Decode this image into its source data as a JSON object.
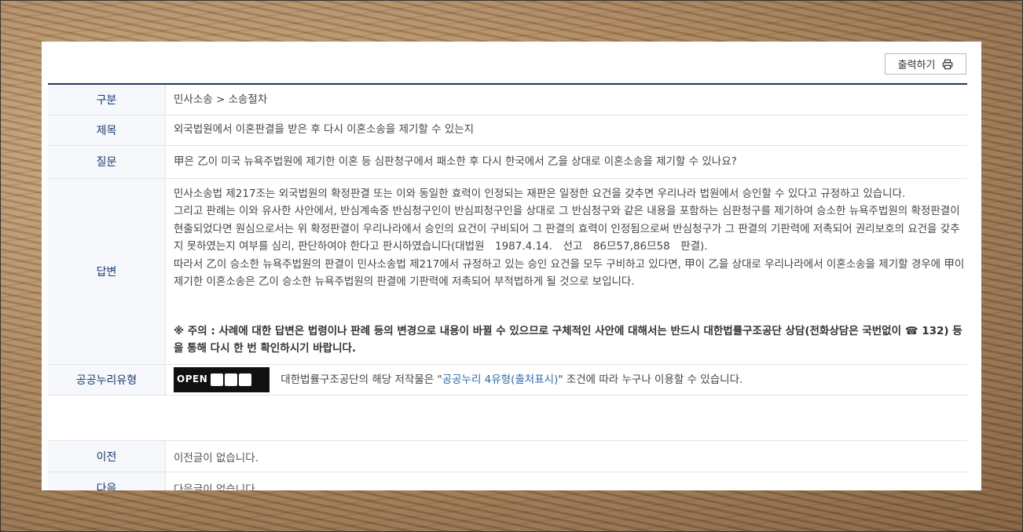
{
  "toolbar": {
    "print_label": "출력하기",
    "print_icon": "printer-icon"
  },
  "rows": {
    "category": {
      "label": "구분",
      "value": "민사소송 > 소송절차"
    },
    "title": {
      "label": "제목",
      "value": "외국법원에서 이혼판결을 받은 후 다시 이혼소송을 제기할 수 있는지"
    },
    "question": {
      "label": "질문",
      "value": "甲은 乙이 미국 뉴욕주법원에 제기한 이혼 등 심판청구에서 패소한 후 다시 한국에서 乙을 상대로 이혼소송을 제기할 수 있나요?"
    },
    "answer": {
      "label": "답변",
      "paragraphs": [
        "민사소송법 제217조는 외국법원의 확정판결 또는 이와 동일한 효력이 인정되는 재판은 일정한 요건을 갖추면 우리나라 법원에서 승인할 수 있다고 규정하고 있습니다.",
        "그리고 판례는 이와 유사한 사안에서, 반심계속중 반심청구인이 반심피청구인을 상대로 그 반심청구와 같은 내용을 포함하는 심판청구를 제기하여 승소한 뉴욕주법원의 확정판결이 현출되었다면 원심으로서는 위 확정판결이 우리나라에서 승인의 요건이 구비되어 그 판결의 효력이 인정됨으로써 반심청구가 그 판결의 기판력에 저촉되어 권리보호의 요건을 갖추지 못하였는지 여부를 심리, 판단하여야 한다고 판시하였습니다(대법원　1987.4.14.　선고　86므57,86므58　판결).",
        "따라서 乙이 승소한 뉴욕주법원의 판결이 민사소송법 제217에서 규정하고 있는 승인 요건을 모두 구비하고 있다면, 甲이 乙을 상대로 우리나라에서 이혼소송을 제기할 경우에 甲이 제기한 이혼소송은 乙이 승소한 뉴욕주법원의 판결에 기판력에 저촉되어 부적법하게 될 것으로 보입니다."
      ],
      "notice": "※ 주의 : 사례에 대한 답변은 법령이나 판례 등의 변경으로 내용이 바뀔 수 있으므로 구체적인 사안에 대해서는 반드시 대한법률구조공단 상담(전화상담은 국번없이 ☎ 132) 등을 통해 다시 한 번 확인하시기 바랍니다."
    },
    "license": {
      "label": "공공누리유형",
      "logo_text": "OPEN",
      "text_before": "대한법률구조공단의 해당 저작물은 \"",
      "link_text": "공공누리 4유형(출처표시)",
      "text_after": "\" 조건에 따라 누구나 이용할 수 있습니다."
    }
  },
  "nav": {
    "prev": {
      "label": "이전",
      "value": "이전글이 없습니다."
    },
    "next": {
      "label": "다음",
      "value": "다음글이 없습니다."
    }
  }
}
